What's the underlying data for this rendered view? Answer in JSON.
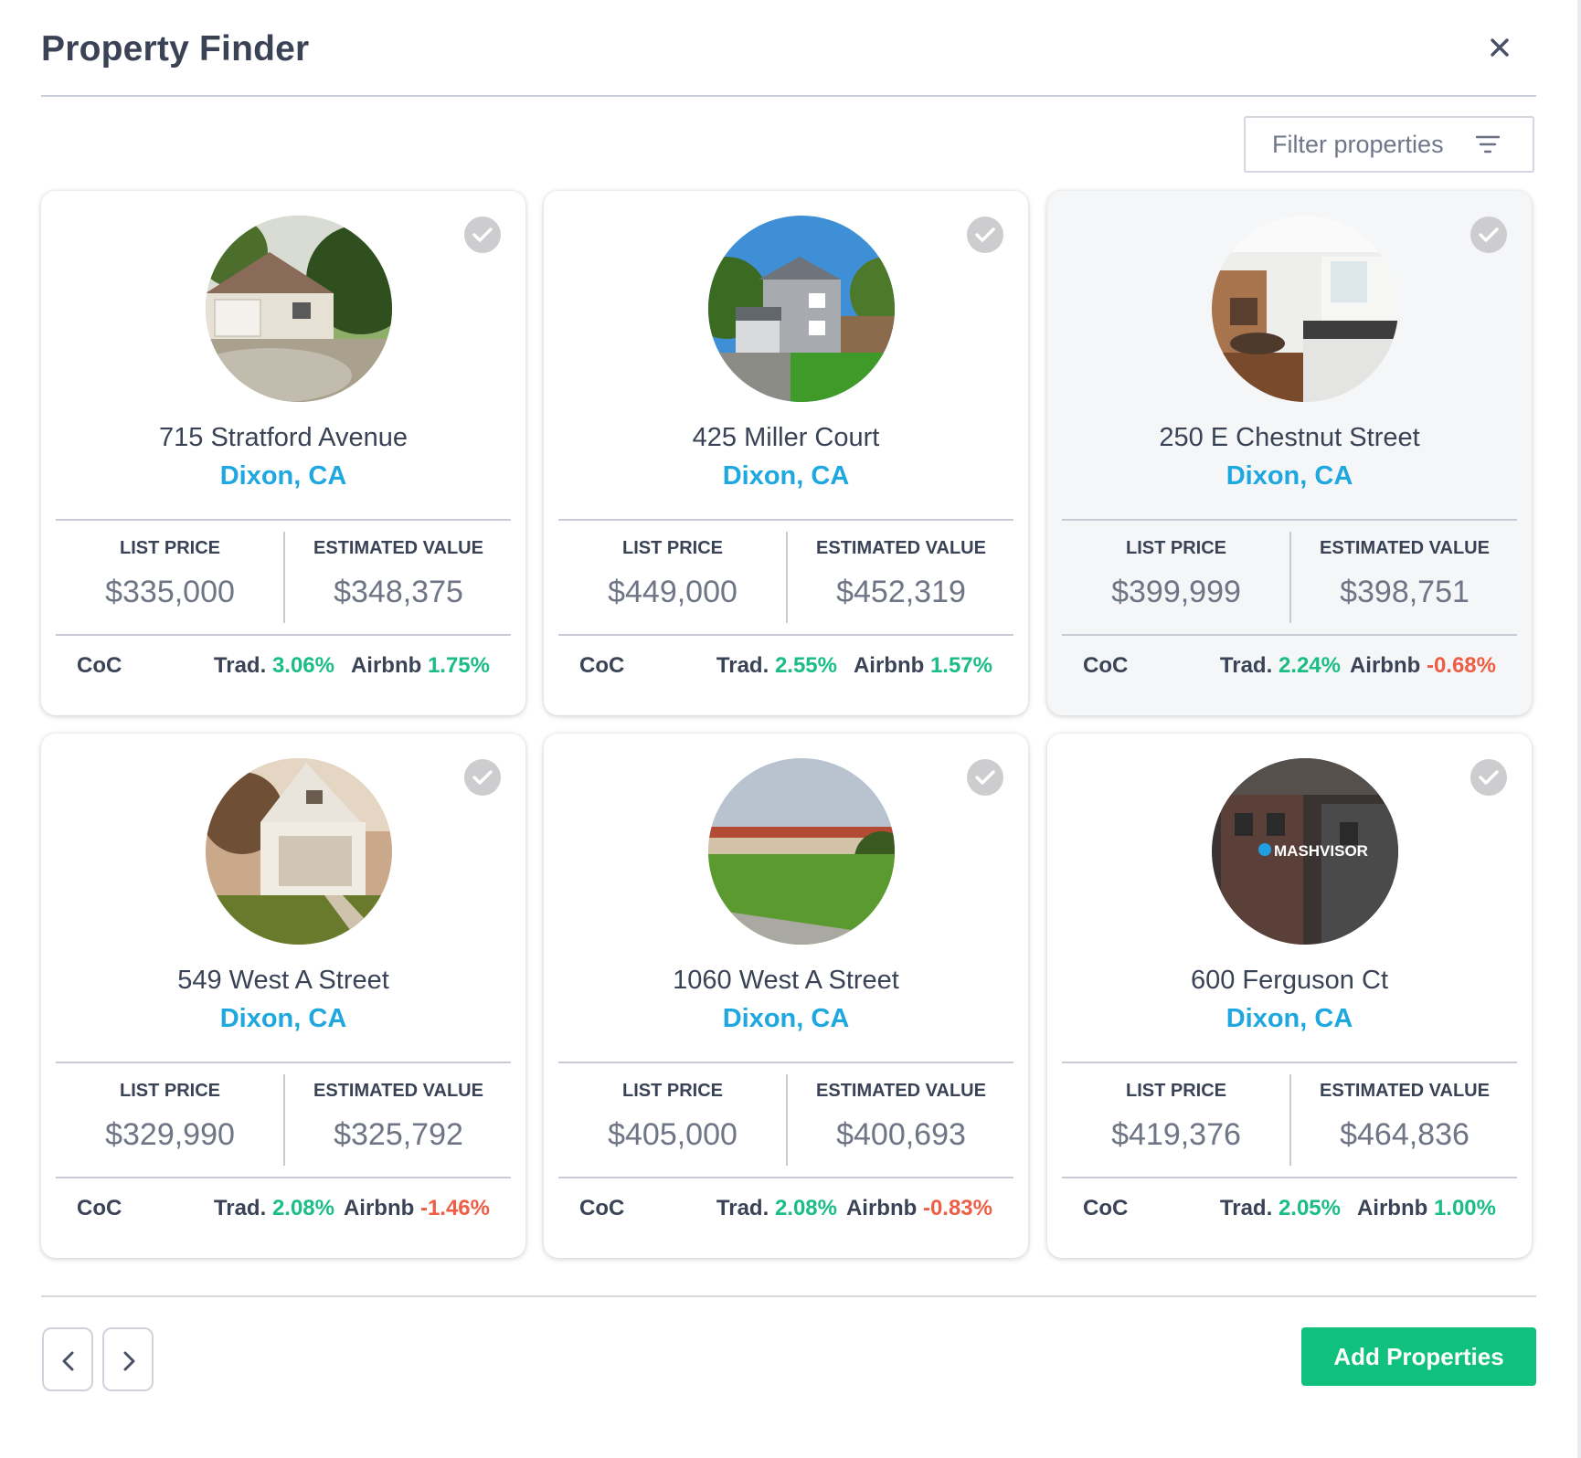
{
  "header": {
    "title": "Property Finder"
  },
  "filter": {
    "placeholder": "Filter properties"
  },
  "labels": {
    "list_price": "LIST PRICE",
    "estimated_value": "ESTIMATED VALUE",
    "coc": "CoC",
    "trad": "Trad.",
    "airbnb": "Airbnb"
  },
  "properties": [
    {
      "address": "715 Stratford Avenue",
      "city": "Dixon, CA",
      "list_price": "$335,000",
      "estimated_value": "$348,375",
      "trad": "3.06%",
      "airbnb": "1.75%",
      "selected": false
    },
    {
      "address": "425 Miller Court",
      "city": "Dixon, CA",
      "list_price": "$449,000",
      "estimated_value": "$452,319",
      "trad": "2.55%",
      "airbnb": "1.57%",
      "selected": false
    },
    {
      "address": "250 E Chestnut Street",
      "city": "Dixon, CA",
      "list_price": "$399,999",
      "estimated_value": "$398,751",
      "trad": "2.24%",
      "airbnb": "-0.68%",
      "selected": true
    },
    {
      "address": "549 West A Street",
      "city": "Dixon, CA",
      "list_price": "$329,990",
      "estimated_value": "$325,792",
      "trad": "2.08%",
      "airbnb": "-1.46%",
      "selected": false
    },
    {
      "address": "1060 West A Street",
      "city": "Dixon, CA",
      "list_price": "$405,000",
      "estimated_value": "$400,693",
      "trad": "2.08%",
      "airbnb": "-0.83%",
      "selected": false
    },
    {
      "address": "600 Ferguson Ct",
      "city": "Dixon, CA",
      "list_price": "$419,376",
      "estimated_value": "$464,836",
      "trad": "2.05%",
      "airbnb": "1.00%",
      "selected": false,
      "photo_watermark": "MASHVISOR"
    }
  ],
  "footer": {
    "add_button": "Add Properties"
  },
  "icons": {
    "close": "close-icon",
    "filter": "filter-icon",
    "check": "check-circle-icon",
    "prev": "chevron-left-icon",
    "next": "chevron-right-icon"
  },
  "colors": {
    "accent_green": "#10c17d",
    "positive": "#1bbd86",
    "negative": "#ee5e45",
    "city_blue": "#1fa7df",
    "text_dark": "#3a4256"
  }
}
